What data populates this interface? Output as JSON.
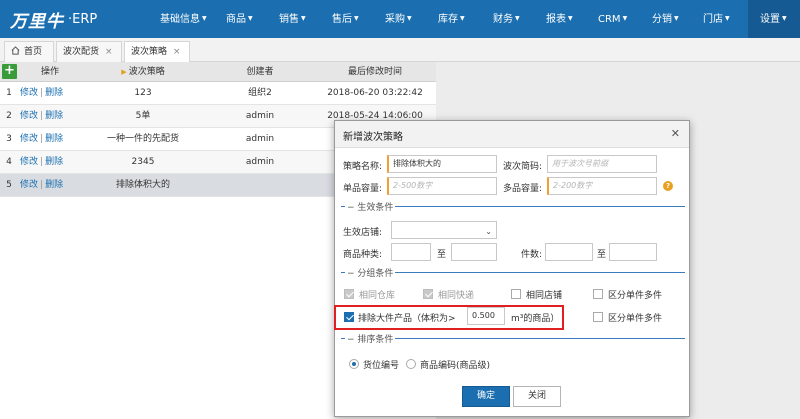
{
  "app": {
    "logo_mark": "万里牛",
    "logo_text": "ERP"
  },
  "nav": {
    "items": [
      {
        "label": "基础信息"
      },
      {
        "label": "商品"
      },
      {
        "label": "销售"
      },
      {
        "label": "售后"
      },
      {
        "label": "采购"
      },
      {
        "label": "库存"
      },
      {
        "label": "财务"
      },
      {
        "label": "报表"
      },
      {
        "label": "CRM"
      },
      {
        "label": "分销"
      },
      {
        "label": "门店"
      },
      {
        "label": "设置"
      }
    ],
    "active": "设置"
  },
  "tabs": [
    {
      "label": "首页",
      "closable": false
    },
    {
      "label": "波次配货",
      "closable": true
    },
    {
      "label": "波次策略",
      "closable": true,
      "active": true
    }
  ],
  "grid": {
    "headers": {
      "ops": "操作",
      "name": "波次策略",
      "creator": "创建者",
      "time": "最后修改时间"
    },
    "edit_label": "修改",
    "delete_label": "删除",
    "rows": [
      {
        "idx": "1",
        "name": "123",
        "creator": "组织2",
        "time": "2018-06-20 03:22:42"
      },
      {
        "idx": "2",
        "name": "5单",
        "creator": "admin",
        "time": "2018-05-24 14:06:00"
      },
      {
        "idx": "3",
        "name": "一种一件的先配货",
        "creator": "admin",
        "time": ""
      },
      {
        "idx": "4",
        "name": "2345",
        "creator": "admin",
        "time": ""
      },
      {
        "idx": "5",
        "name": "排除体积大的",
        "creator": "",
        "time": ""
      }
    ]
  },
  "dialog": {
    "title": "新增波次策略",
    "strategy_name_label": "策略名称:",
    "strategy_name_value": "排除体积大的",
    "wave_code_label": "波次简码:",
    "wave_code_placeholder": "用于波次号前缀",
    "single_capacity_label": "单品容量:",
    "single_capacity_placeholder": "2-500数字",
    "multi_capacity_label": "多品容量:",
    "multi_capacity_placeholder": "2-200数字",
    "section_effect": "生效条件",
    "store_label": "生效店铺:",
    "product_kinds_label": "商品种类:",
    "to_label": "至",
    "pieces_label": "件数:",
    "section_group": "分组条件",
    "same_warehouse": "相同仓库",
    "same_express": "相同快递",
    "same_store": "相同店铺",
    "distinguish_single_multi": "区分单件多件",
    "exclude_large_label": "排除大件产品（体积为>",
    "volume_value": "0.500",
    "volume_unit": "m³的商品）",
    "section_sort": "排序条件",
    "sort_location": "货位编号",
    "sort_product_code": "商品编码(商品级)",
    "confirm": "确定",
    "close": "关闭"
  }
}
